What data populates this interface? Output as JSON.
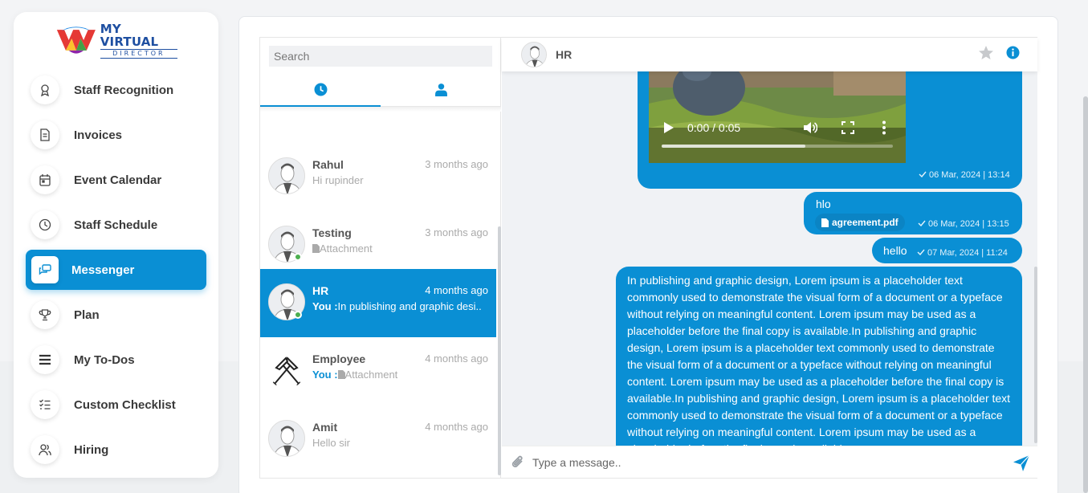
{
  "sidebar": {
    "logo": {
      "line1": "MY VIRTUAL",
      "line2": "DIRECTOR"
    },
    "items": [
      {
        "label": "Staff Recognition",
        "icon": "award-icon"
      },
      {
        "label": "Invoices",
        "icon": "document-icon"
      },
      {
        "label": "Event Calendar",
        "icon": "calendar-icon"
      },
      {
        "label": "Staff Schedule",
        "icon": "clock-icon"
      },
      {
        "label": "Messenger",
        "icon": "chat-icon",
        "active": true
      },
      {
        "label": "Plan",
        "icon": "trophy-icon"
      },
      {
        "label": "My To-Dos",
        "icon": "menu-lines-icon"
      },
      {
        "label": "Custom Checklist",
        "icon": "checklist-icon"
      },
      {
        "label": "Hiring",
        "icon": "users-icon"
      }
    ]
  },
  "contacts": {
    "search_placeholder": "Search",
    "tabs": [
      {
        "name": "recent",
        "icon": "clock-icon",
        "active": true
      },
      {
        "name": "contacts",
        "icon": "user-icon"
      }
    ],
    "list": [
      {
        "name": "Rahul",
        "time": "3 months ago",
        "you_prefix": "",
        "preview": "Hi rupinder",
        "attachment": false,
        "online": false,
        "active": false
      },
      {
        "name": "Testing",
        "time": "3 months ago",
        "you_prefix": "",
        "preview": "Attachment",
        "attachment": true,
        "online": true,
        "active": false
      },
      {
        "name": "HR",
        "time": "4 months ago",
        "you_prefix": "You :",
        "preview": "In publishing and graphic desi..",
        "attachment": false,
        "online": true,
        "active": true
      },
      {
        "name": "Employee",
        "time": "4 months ago",
        "you_prefix": "You :",
        "preview": "Attachment",
        "attachment": true,
        "online": false,
        "active": false
      },
      {
        "name": "Amit",
        "time": "4 months ago",
        "you_prefix": "",
        "preview": "Hello sir",
        "attachment": false,
        "online": false,
        "active": false
      }
    ]
  },
  "conversation": {
    "header_name": "HR",
    "messages": [
      {
        "type": "video",
        "video_time": "0:00 / 0:05",
        "progress": 0.62,
        "meta": "06 Mar, 2024 | 13:14"
      },
      {
        "type": "text_attachment",
        "text": "hlo",
        "attachment": "agreement.pdf",
        "meta": "06 Mar, 2024 | 13:15"
      },
      {
        "type": "text",
        "text": "hello",
        "meta": "07 Mar, 2024 | 11:24"
      },
      {
        "type": "long_text",
        "text": "In publishing and graphic design, Lorem ipsum is a placeholder text commonly used to demonstrate the visual form of a document or a typeface without relying on meaningful content. Lorem ipsum may be used as a placeholder before the final copy is available.In publishing and graphic design, Lorem ipsum is a placeholder text commonly used to demonstrate the visual form of a document or a typeface without relying on meaningful content. Lorem ipsum may be used as a placeholder before the final copy is available.In publishing and graphic design, Lorem ipsum is a placeholder text commonly used to demonstrate the visual form of a document or a typeface without relying on meaningful content. Lorem ipsum may be used as a placeholder before the final copy is available."
      }
    ],
    "composer_placeholder": "Type a message.."
  },
  "colors": {
    "accent": "#0a8fd4",
    "online": "#4caf50"
  }
}
